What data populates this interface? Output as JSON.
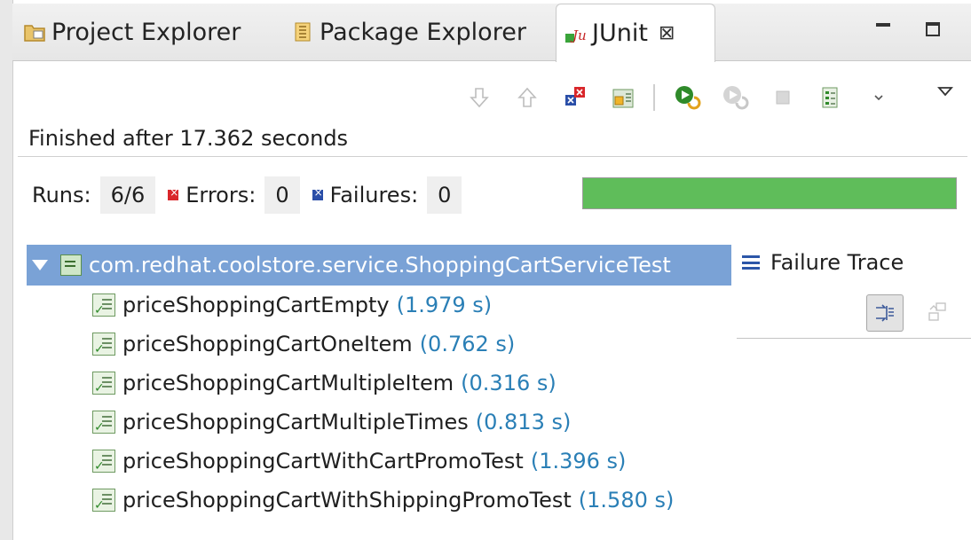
{
  "tabs": [
    {
      "label": "Project Explorer",
      "icon": "project-explorer-icon"
    },
    {
      "label": "Package Explorer",
      "icon": "package-explorer-icon"
    },
    {
      "label": "JUnit",
      "icon": "junit-icon",
      "active": true
    }
  ],
  "toolbar": {
    "icons": [
      "next-failure-icon",
      "previous-failure-icon",
      "show-failures-only-icon",
      "scroll-lock-icon",
      "rerun-test-icon",
      "rerun-failed-first-icon",
      "stop-icon",
      "test-run-history-icon",
      "history-dropdown-icon"
    ]
  },
  "status": {
    "finished_text": "Finished after 17.362 seconds"
  },
  "counters": {
    "runs_label": "Runs:",
    "runs_value": "6/6",
    "errors_label": "Errors:",
    "errors_value": "0",
    "failures_label": "Failures:",
    "failures_value": "0",
    "progress_fraction": 1.0,
    "progress_color": "#5fbd5a"
  },
  "tree": {
    "root_label": "com.redhat.coolstore.service.ShoppingCartServiceTest",
    "items": [
      {
        "name": "priceShoppingCartEmpty",
        "time": "(1.979 s)"
      },
      {
        "name": "priceShoppingCartOneItem",
        "time": "(0.762 s)"
      },
      {
        "name": "priceShoppingCartMultipleItem",
        "time": "(0.316 s)"
      },
      {
        "name": "priceShoppingCartMultipleTimes",
        "time": "(0.813 s)"
      },
      {
        "name": "priceShoppingCartWithCartPromoTest",
        "time": "(1.396 s)"
      },
      {
        "name": "priceShoppingCartWithShippingPromoTest",
        "time": "(1.580 s)"
      }
    ]
  },
  "trace": {
    "header": "Failure Trace"
  },
  "colors": {
    "selection": "#7aa2d6",
    "time_text": "#2a7fb6",
    "error": "#d9262a",
    "failure": "#2a4ea8"
  }
}
